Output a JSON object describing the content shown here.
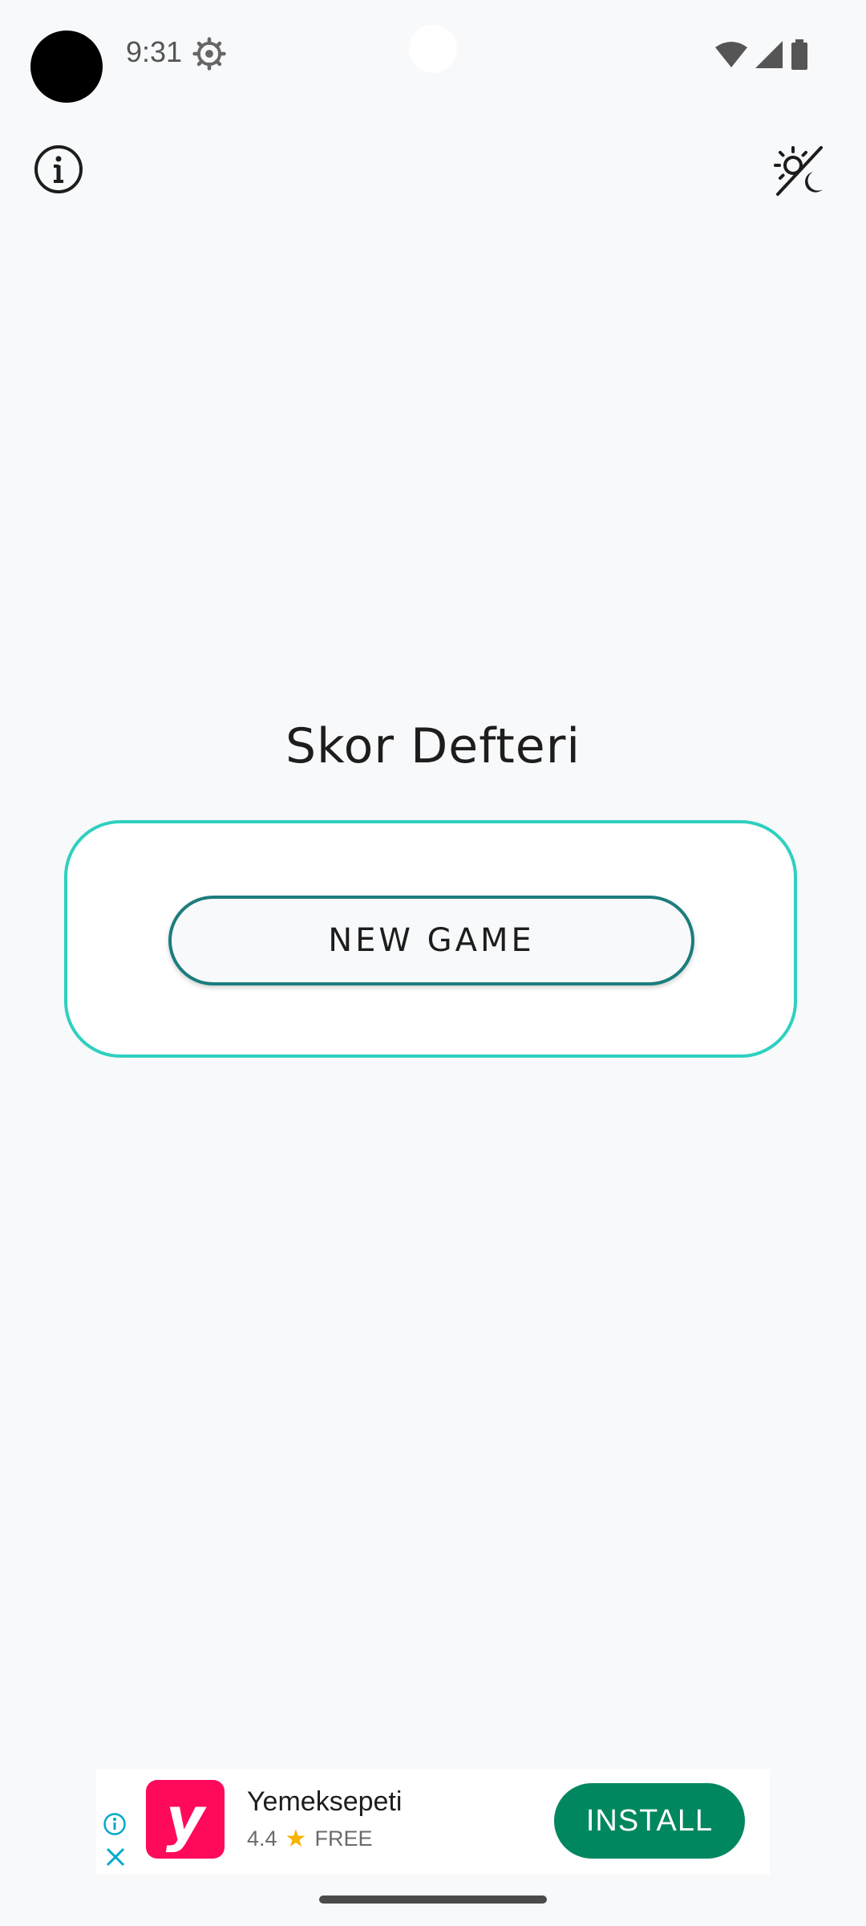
{
  "status_bar": {
    "time": "9:31",
    "icons": [
      "settings-gear-icon",
      "wifi-icon",
      "signal-icon",
      "battery-icon"
    ]
  },
  "toolbar": {
    "info_icon": "info-icon",
    "theme_icon": "dark-mode-toggle-icon"
  },
  "main": {
    "title": "Skor Defteri",
    "new_game_label": "NEW GAME"
  },
  "ad": {
    "app_name": "Yemeksepeti",
    "rating": "4.4",
    "price": "FREE",
    "install_label": "INSTALL",
    "icon_letter": "y",
    "colors": {
      "icon_bg": "#ff0a5a",
      "install_bg": "#01875f",
      "star": "#f5b400",
      "adchoices": "#00aac8"
    }
  },
  "colors": {
    "card_border": "#2fd0c0",
    "button_border": "#1b7d7d",
    "background": "#f8f9fa"
  }
}
